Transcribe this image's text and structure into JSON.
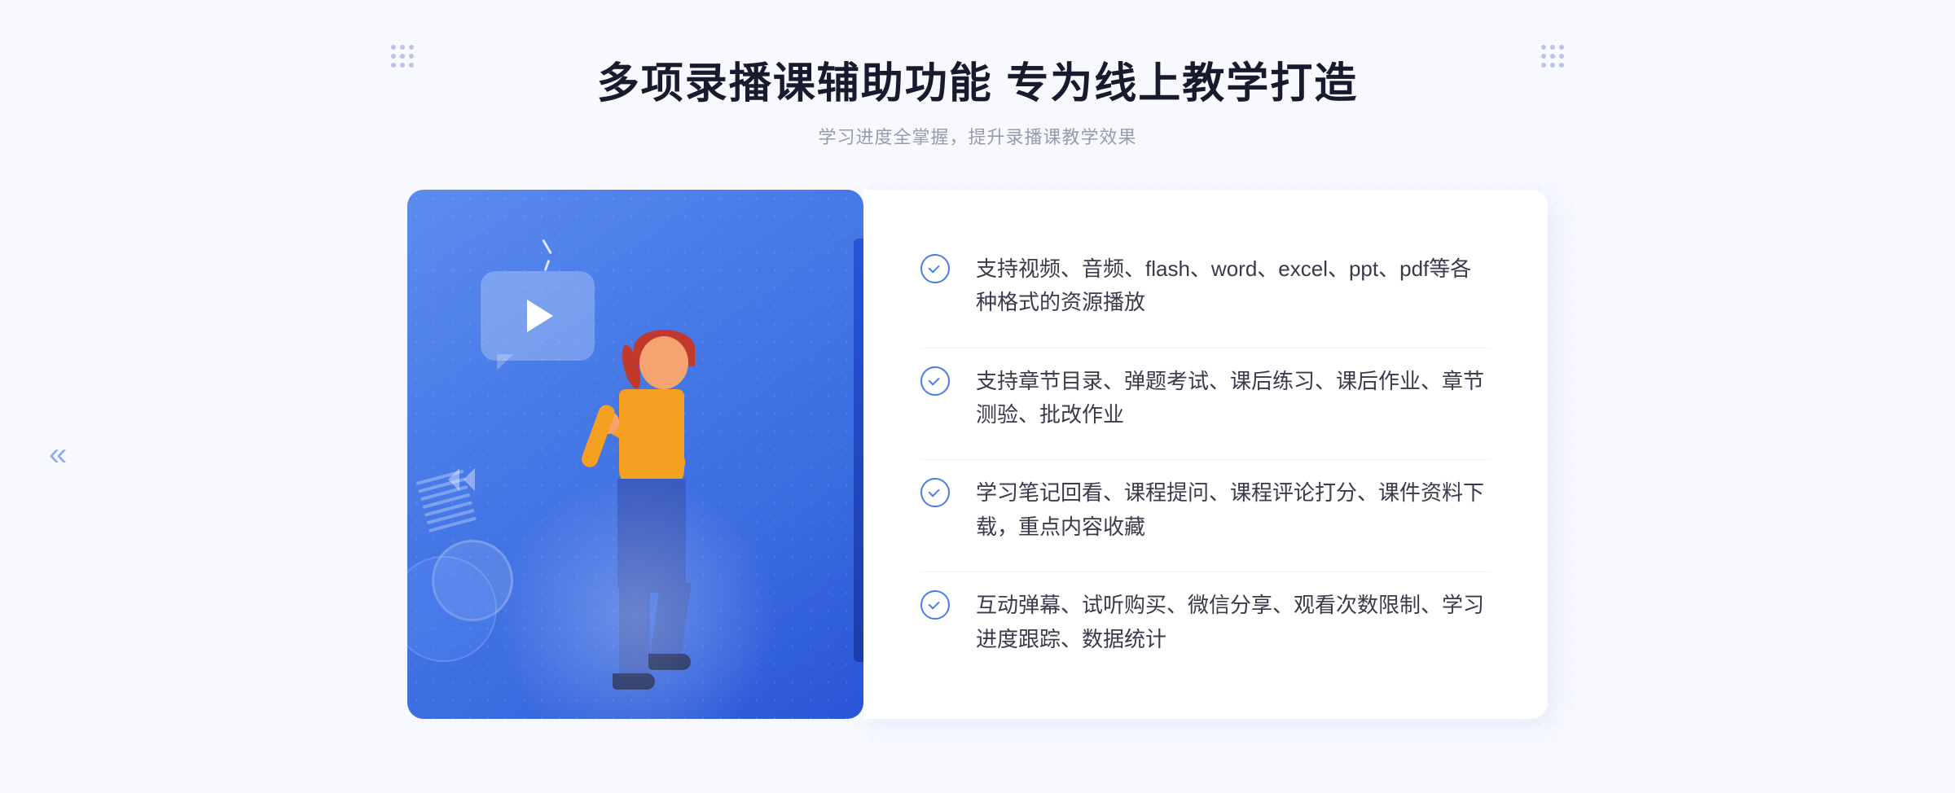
{
  "page": {
    "background_color": "#f4f6ff"
  },
  "header": {
    "title": "多项录播课辅助功能 专为线上教学打造",
    "subtitle": "学习进度全掌握，提升录播课教学效果"
  },
  "features": [
    {
      "id": 1,
      "text": "支持视频、音频、flash、word、excel、ppt、pdf等各种格式的资源播放"
    },
    {
      "id": 2,
      "text": "支持章节目录、弹题考试、课后练习、课后作业、章节测验、批改作业"
    },
    {
      "id": 3,
      "text": "学习笔记回看、课程提问、课程评论打分、课件资料下载，重点内容收藏"
    },
    {
      "id": 4,
      "text": "互动弹幕、试听购买、微信分享、观看次数限制、学习进度跟踪、数据统计"
    }
  ],
  "decorative": {
    "left_chevrons": "«",
    "right_chevrons": "»"
  }
}
